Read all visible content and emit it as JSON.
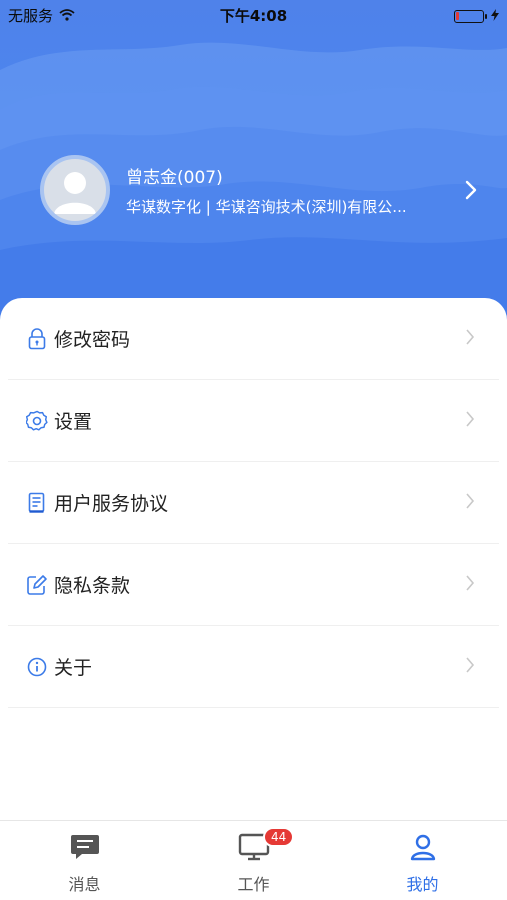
{
  "status_bar": {
    "carrier": "无服务",
    "time": "下午4:08",
    "battery_level": 0.12
  },
  "profile": {
    "name": "曾志金(007)",
    "organization": "华谋数字化 | 华谋咨询技术(深圳)有限公..."
  },
  "menu": {
    "items": [
      {
        "label": "修改密码",
        "icon": "lock-icon"
      },
      {
        "label": "设置",
        "icon": "gear-icon"
      },
      {
        "label": "用户服务协议",
        "icon": "document-icon"
      },
      {
        "label": "隐私条款",
        "icon": "edit-icon"
      },
      {
        "label": "关于",
        "icon": "info-icon"
      }
    ]
  },
  "tabbar": {
    "tabs": [
      {
        "label": "消息",
        "icon": "message-icon"
      },
      {
        "label": "工作",
        "icon": "monitor-icon",
        "badge": "44"
      },
      {
        "label": "我的",
        "icon": "user-icon",
        "active": true
      }
    ]
  },
  "colors": {
    "accent": "#2f6fe6",
    "hero_blue": "#4b86f0",
    "badge_red": "#e53935"
  }
}
